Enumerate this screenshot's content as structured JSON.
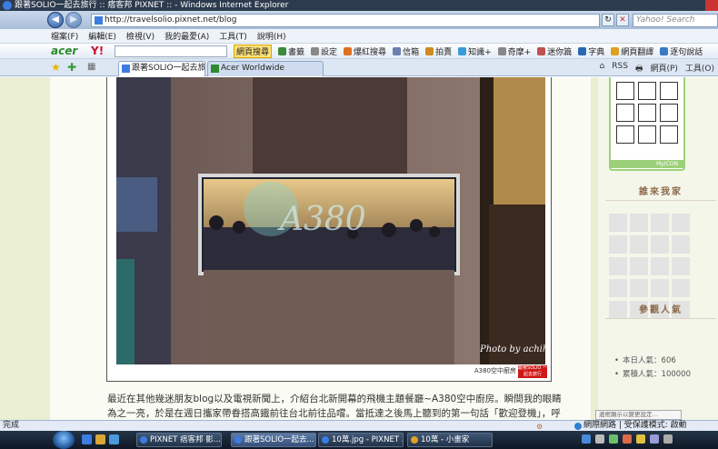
{
  "window": {
    "title": "跟著SOLIO一起去旅行 :: 痞客邦 PIXNET :: - Windows Internet Explorer"
  },
  "address_bar": {
    "url": "http://travelsolio.pixnet.net/blog",
    "search_placeholder": "Yahoo! Search",
    "refresh_glyph": "↻",
    "stop_glyph": "✕"
  },
  "menu": {
    "items": [
      "檔案(F)",
      "編輯(E)",
      "檢視(V)",
      "我的最愛(A)",
      "工具(T)",
      "說明(H)"
    ]
  },
  "toolbar": {
    "acer_logo": "acer",
    "yahoo_logo": "Y!",
    "buttons": [
      {
        "label": "網頁搜尋",
        "highlight": true
      },
      {
        "label": "書籤",
        "color": "#3a8a3a"
      },
      {
        "label": "設定",
        "color": "#888888"
      },
      {
        "label": "爆紅搜尋",
        "color": "#e07020"
      },
      {
        "label": "信箱",
        "color": "#6a7fb0"
      },
      {
        "label": "拍賣",
        "color": "#d08a20"
      },
      {
        "label": "知識+",
        "color": "#3a9ad9"
      },
      {
        "label": "奇摩+",
        "color": "#888888"
      },
      {
        "label": "迷你篇",
        "color": "#c05050"
      },
      {
        "label": "字典",
        "color": "#2a6ab0"
      },
      {
        "label": "網頁翻譯",
        "color": "#e0a020"
      },
      {
        "label": "逐句說話",
        "color": "#3a7ac0"
      }
    ]
  },
  "tabs": [
    {
      "label": "跟著SOLIO一起去旅行 ...",
      "active": true,
      "icon_color": "#3b7de0"
    },
    {
      "label": "Acer Worldwide",
      "active": false,
      "icon_color": "#2d8a2d"
    }
  ],
  "tab_right_tools": [
    "⌂",
    "RSS",
    "🖶",
    "網頁(P)",
    "工具(O)"
  ],
  "post": {
    "image_caption": "A380空中廚房",
    "photo_credit": "Photo by achih",
    "stamp_text": "跟著SOLIO 一起去旅行",
    "sign_text": "A380",
    "paragraph": "最近在其他幾迷朋友blog以及電視新聞上，介紹台北新開幕的飛機主題餐廳~A380空中廚房。瞬間我的眼睛為之一亮，於是在週日攜家帶眷搭高鐵前往台北前往品嚐。當抵達之後馬上聽到的第一句話「歡迎登機」，呼～有搭乘機的"
  },
  "sidebar": {
    "icon_widget_brand": "MyICON",
    "visitor_title": "誰來我家",
    "stats_title": "參觀人氣",
    "stats": [
      {
        "label": "本日人氣：",
        "value": "606"
      },
      {
        "label": "累積人氣：",
        "value": "100000"
      }
    ],
    "tooltip": "邊框顯示以變更設定…"
  },
  "status": {
    "left": "完成",
    "zone": "網際網路 | 受保護模式: 啟動"
  },
  "taskbar": {
    "tasks": [
      {
        "label": "PIXNET 痞客邦 影...",
        "active": false,
        "icon_color": "#3b7de0"
      },
      {
        "label": "跟著SOLIO一起去...",
        "active": true,
        "icon_color": "#3b7de0"
      },
      {
        "label": "10萬.jpg - PIXNET ...",
        "active": false,
        "icon_color": "#3b7de0"
      },
      {
        "label": "10萬 - 小畫家",
        "active": false,
        "icon_color": "#e0a020"
      }
    ]
  },
  "colors": {
    "content_bg": "#eaeed3",
    "sidebar_title": "#8b6a4a",
    "widget_green": "#9cd17a"
  }
}
